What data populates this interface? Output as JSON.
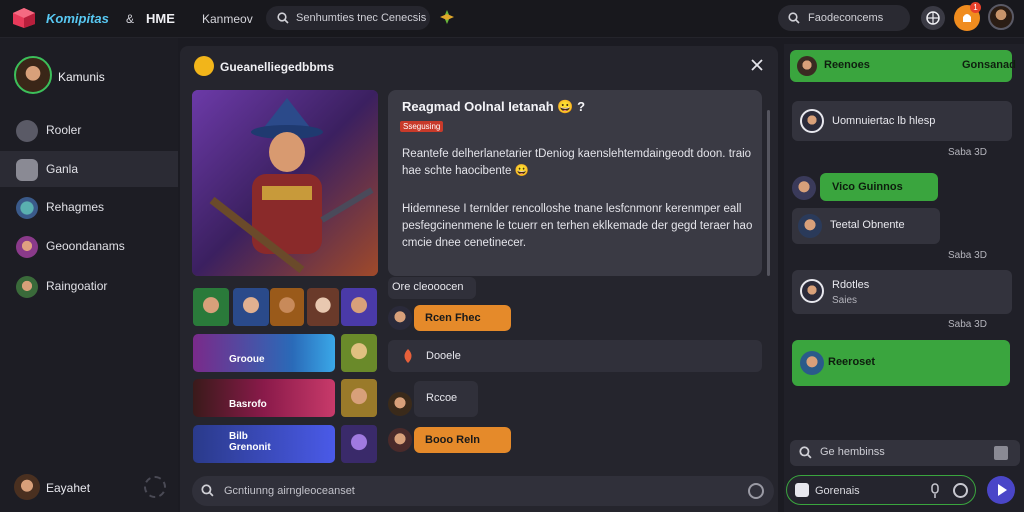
{
  "topbar": {
    "brand": "Komipitas",
    "brand_amp": "&",
    "brand_second": "HME",
    "nav_label": "Kanmeov",
    "search_text": "Senhumties tnec Cenecsis",
    "right_search_text": "Faodeconcems",
    "notification_count": "1"
  },
  "sidebar": {
    "profile_name": "Kamunis",
    "items": [
      {
        "label": "Rooler"
      },
      {
        "label": "Ganla"
      },
      {
        "label": "Rehagmes"
      },
      {
        "label": "Geoondanams"
      },
      {
        "label": "Raingoatior"
      }
    ],
    "footer_name": "Eayahet"
  },
  "main": {
    "title": "Gueanelliegedbbms",
    "info": {
      "title": "Reagmad Oolnal Ietanah 😀 ?",
      "tag": "Ssegusing",
      "p1": "Reantefe delherlanetarier tDeniog kaenslehtemdaingeodt doon. traio hae schte haocibente 😀",
      "p2": "Hidemnese I ternlder rencolloshe tnane lesfcnmonr kerenmper eall pesfegcinenmene le tcuerr en terhen eklkemade der gegd teraer hao cmcie dnee cenetinecer."
    },
    "tiles": [
      {
        "caption": "Grooue"
      },
      {
        "caption": "Basrofo"
      },
      {
        "caption": "Bilb Grenonit"
      }
    ],
    "messages": [
      {
        "text": "Ore cleooocen"
      },
      {
        "text": "Rcen Fhec"
      },
      {
        "text": "Dooele"
      },
      {
        "text": "Rccoe"
      },
      {
        "text": "Booo Reln"
      }
    ],
    "compose_placeholder": "Gcntiunng airngleoceanset"
  },
  "chat": {
    "header_name": "Reenoes",
    "header_right": "Gonsanad",
    "messages": [
      {
        "text": "Uomnuiertac lb hlesp",
        "time": "Saba  3D",
        "type": "in"
      },
      {
        "text": "Vico Guinnos",
        "type": "out"
      },
      {
        "text": "Teetal Obnente",
        "time": "Saba  3D",
        "type": "in"
      },
      {
        "text": "Rdotles",
        "sub": "Saies",
        "time": "Saba  3D",
        "type": "in"
      },
      {
        "text": "Reeroset",
        "type": "out"
      }
    ],
    "search_text": "Ge hembinss",
    "input_placeholder": "Gorenais"
  },
  "colors": {
    "accent_green": "#3aa53e",
    "accent_orange": "#e58a2a",
    "send_blue": "#4a46c8"
  }
}
